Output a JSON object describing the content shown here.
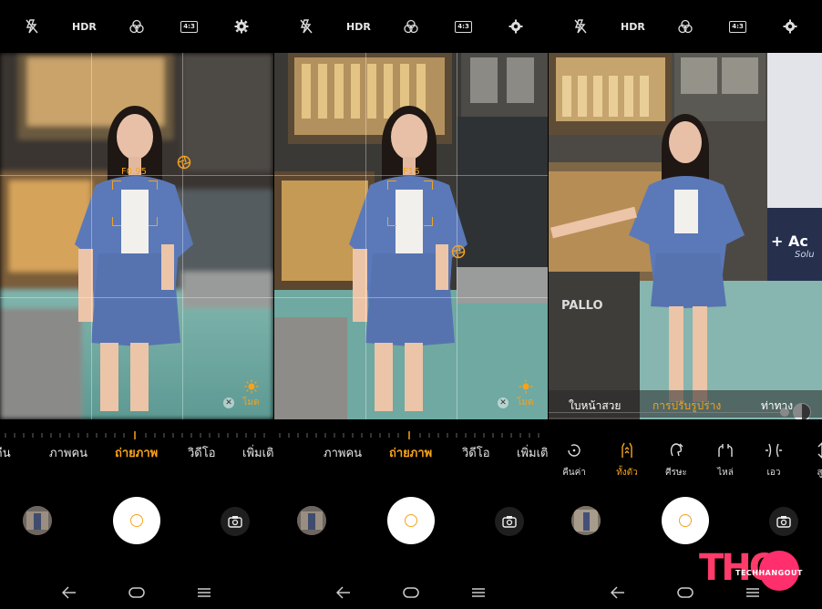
{
  "topbar": {
    "hdr": "HDR",
    "ratio": "4:3"
  },
  "panel1": {
    "aperture": "F0.95",
    "modes": [
      "คืน",
      "ภาพคน",
      "ถ่ายภาพ",
      "วิดีโอ",
      "เพิ่มเติมคืน"
    ],
    "active_mode": "ถ่ายภาพ",
    "lighting_label": "โมด"
  },
  "panel2": {
    "aperture": "F16",
    "modes": [
      "ภาพคน",
      "ถ่ายภาพ",
      "วิดีโอ",
      "เพิ่มเติ"
    ],
    "active_mode": "ถ่ายภาพ",
    "lighting_label": "โมด"
  },
  "panel3": {
    "beauty_tabs": [
      "ใบหน้าสวย",
      "การปรับรูปร่าง",
      "ท่าทาง"
    ],
    "active_tab": "การปรับรูปร่าง",
    "beauty_tools": [
      {
        "label": "คืนค่า",
        "icon": "reset-icon"
      },
      {
        "label": "ทั้งตัว",
        "icon": "whole-body-icon"
      },
      {
        "label": "ศีรษะ",
        "icon": "head-icon"
      },
      {
        "label": "ไหล่",
        "icon": "shoulder-icon"
      },
      {
        "label": "เอว",
        "icon": "waist-icon"
      },
      {
        "label": "สูง",
        "icon": "height-icon"
      }
    ],
    "active_tool": "ทั้งตัว",
    "store_sign": "PALLO",
    "billboard_text": "+ Ac",
    "billboard_sub": "Solu"
  },
  "watermark": {
    "brand": "THO",
    "tagline": "TECHHANGOUT"
  },
  "colors": {
    "accent": "#f7a21b",
    "background": "#000000"
  }
}
